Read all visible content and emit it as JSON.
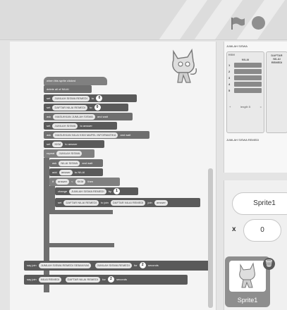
{
  "stage_monitors": {
    "jumlah_siswa_label": "JUMLAH SISWA",
    "jumlah_siswa_value": "",
    "kkm_label": "KKM",
    "kkm_value": "",
    "list_nilai": {
      "header": "NILAI",
      "rows": [
        "1",
        "2",
        "3",
        "4",
        "5"
      ],
      "footer_length": "length 5",
      "footer_eq": "="
    },
    "list_daftar": {
      "header": "DAFTAR NILAI REMEDI"
    },
    "jumlah_remedi_label": "JUMLAH SISWA REMEDI",
    "jumlah_remedi_value": ""
  },
  "sprite_info": {
    "name": "Sprite1",
    "x_label": "x",
    "x_value": "0"
  },
  "sprite_thumb": {
    "label": "Sprite1",
    "delete_icon": "trash-icon"
  },
  "code_blocks": [
    {
      "text": "when this sprite clicked"
    },
    {
      "text": "delete all of NILAI"
    },
    {
      "parts": [
        "set",
        "JUMLAH SISWA REMEDI",
        "to"
      ],
      "num": "0"
    },
    {
      "parts": [
        "set",
        "DAFTAR NILAI REMEDI",
        "to"
      ],
      "num": "0"
    },
    {
      "parts": [
        "ask",
        "MASUKKAN JUMLAH SISWA",
        "and wait"
      ]
    },
    {
      "parts": [
        "set",
        "JUMLAH SISWA",
        "to",
        "answer"
      ]
    },
    {
      "parts": [
        "ask",
        "MASUKKAN NILAI KKM MAPEL INFORMATIKA",
        "and wait"
      ]
    },
    {
      "parts": [
        "set",
        "KKM",
        "to",
        "answer"
      ]
    },
    {
      "parts": [
        "repeat",
        "JUMLAH SISWA"
      ]
    },
    {
      "parts": [
        "ask",
        "NILAI SISWA",
        "and wait"
      ]
    },
    {
      "parts": [
        "add",
        "answer",
        "to",
        "NILAI"
      ]
    },
    {
      "parts": [
        "if",
        "answer",
        "<",
        "KKM",
        "then"
      ]
    },
    {
      "parts": [
        "change",
        "JUMLAH SISWA REMEDI",
        "by"
      ],
      "num": "1"
    },
    {
      "parts": [
        "set",
        "DAFTAR NILAI REMEDI",
        "to",
        "join",
        "DAFTAR NILAI REMEDI",
        "join",
        "answer"
      ]
    },
    {
      "parts": [
        "say",
        "join",
        "JUMLAH SISWA REMEDI SEBANYAK",
        "JUMLAH SISWA REMEDI",
        "for",
        "seconds"
      ],
      "num": "2"
    },
    {
      "parts": [
        "say",
        "join",
        "NILAI REMEDI",
        "DAFTAR NILAI REMEDI",
        "for",
        "seconds"
      ],
      "num": "2"
    }
  ]
}
